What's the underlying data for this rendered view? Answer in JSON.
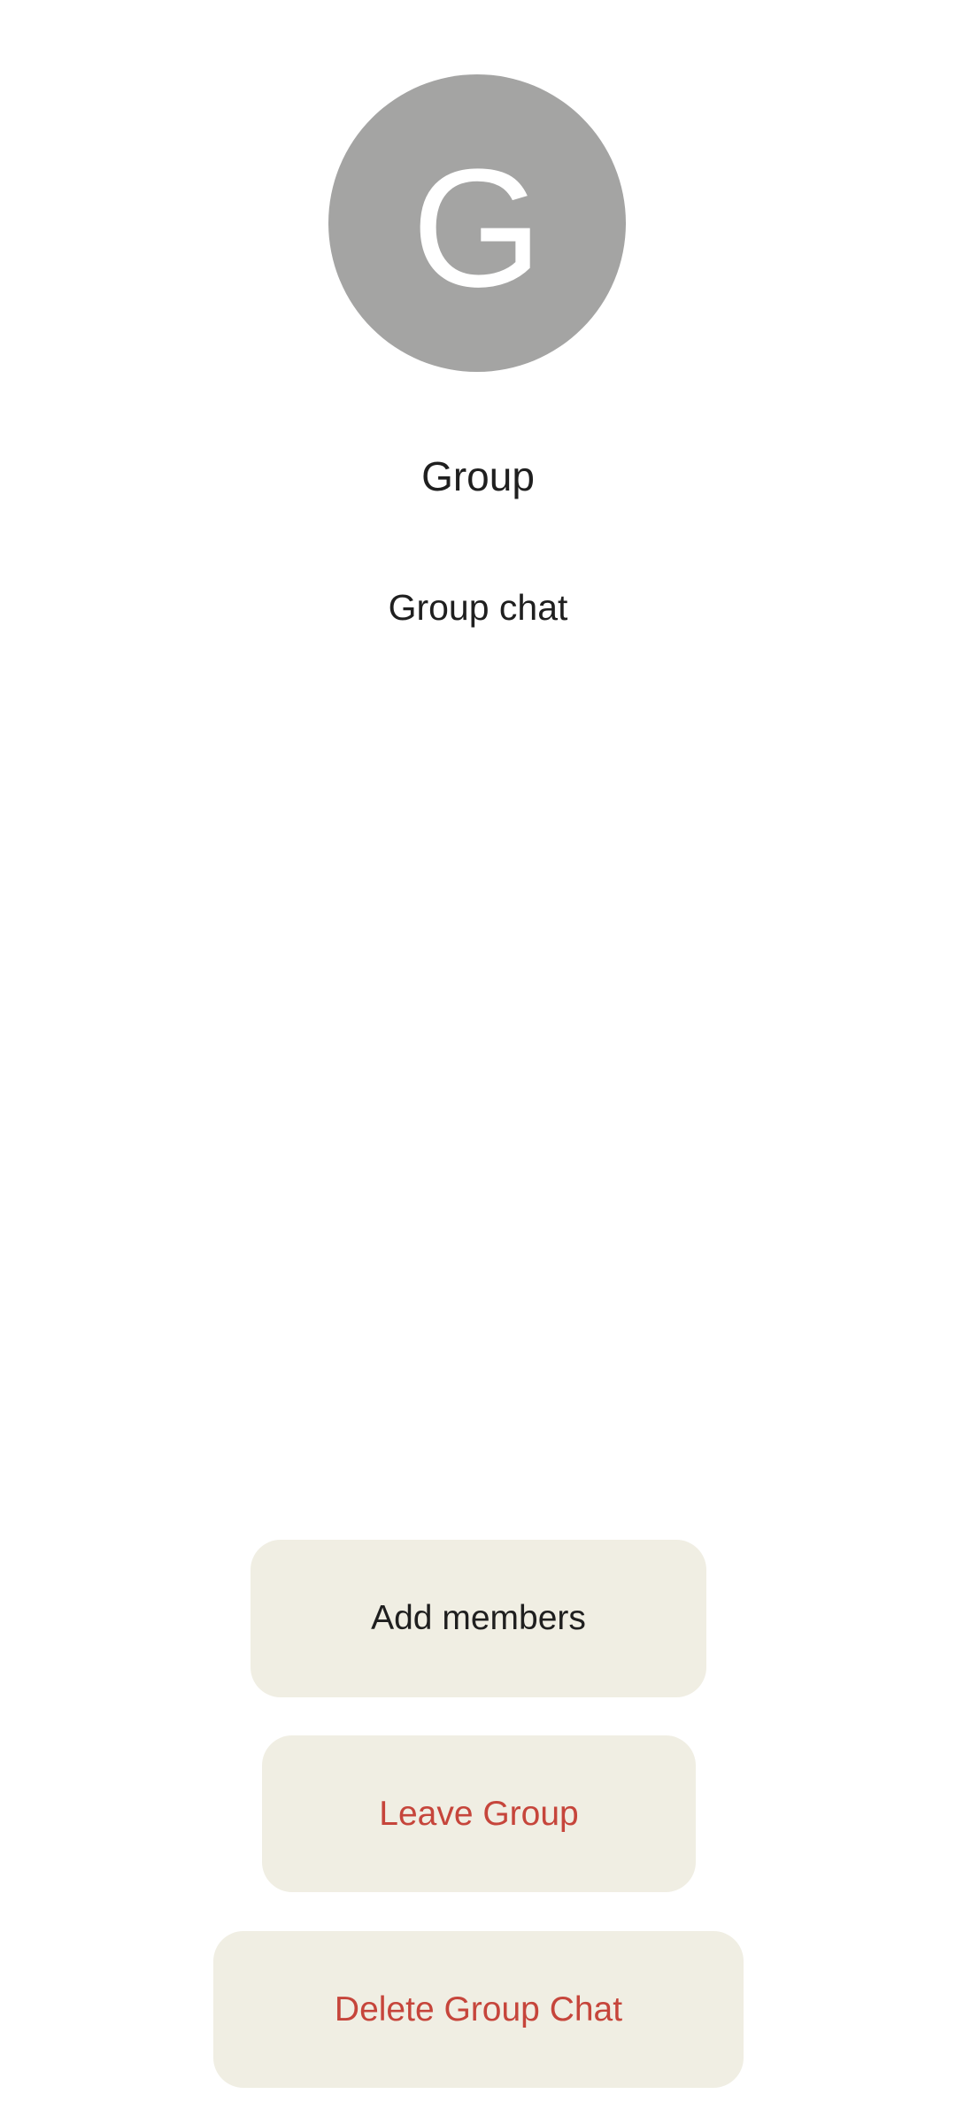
{
  "avatar": {
    "initial": "G",
    "background_color": "#a4a4a3",
    "text_color": "#ffffff"
  },
  "group": {
    "name": "Group",
    "description": "Group chat"
  },
  "actions": {
    "add_members": "Add members",
    "leave_group": "Leave Group",
    "delete_group_chat": "Delete Group Chat"
  },
  "colors": {
    "button_background": "#f0eee3",
    "destructive": "#c6453b",
    "text": "#1f1f1f"
  }
}
